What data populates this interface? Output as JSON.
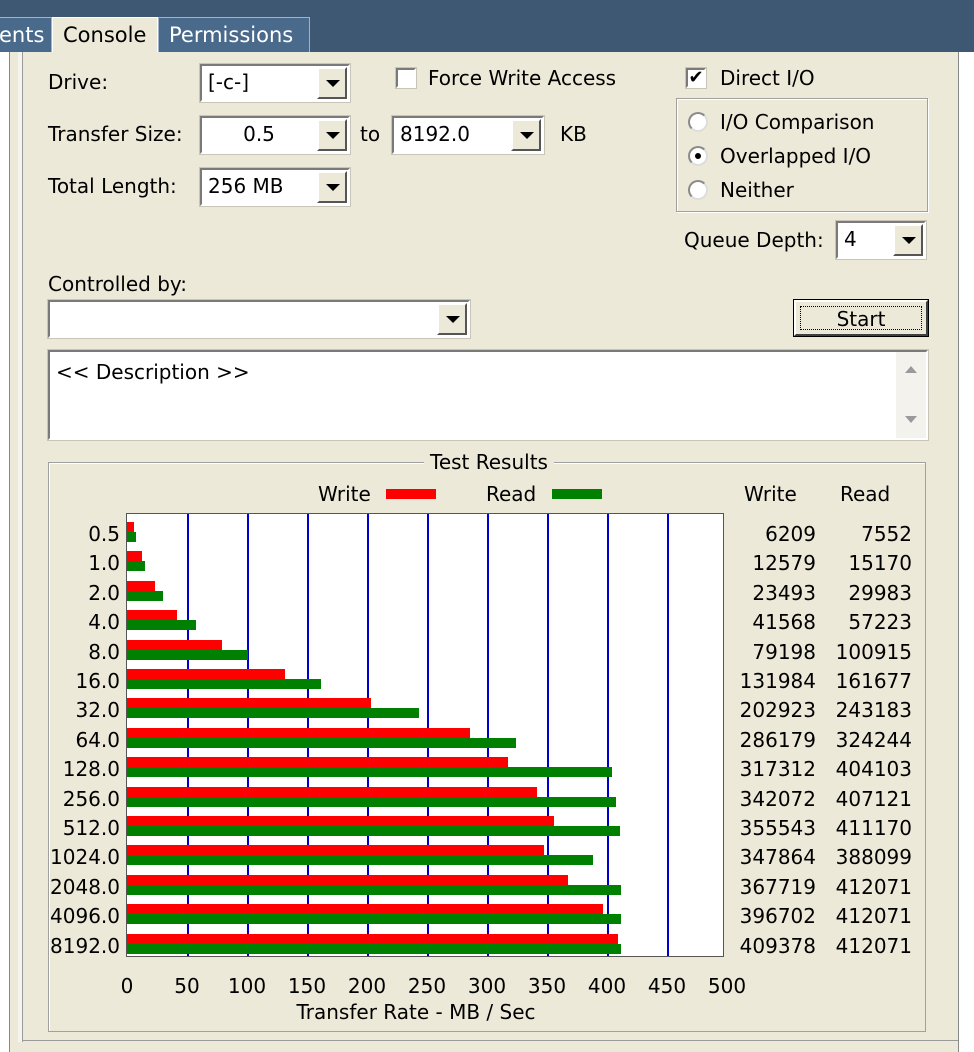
{
  "tabs": [
    {
      "label": "ents",
      "active": false
    },
    {
      "label": "Console",
      "active": true
    },
    {
      "label": "Permissions",
      "active": false
    }
  ],
  "drive": {
    "label": "Drive:",
    "value": "[-c-]"
  },
  "transfer_size": {
    "label": "Transfer Size:",
    "from": "0.5",
    "to_label": "to",
    "to": "8192.0",
    "unit": "KB"
  },
  "total_length": {
    "label": "Total Length:",
    "value": "256 MB"
  },
  "force_write": {
    "label": "Force Write Access",
    "checked": false
  },
  "direct_io": {
    "label": "Direct I/O",
    "checked": true,
    "check_glyph": "✔"
  },
  "io_mode": {
    "options": [
      {
        "label": "I/O Comparison",
        "selected": false
      },
      {
        "label": "Overlapped I/O",
        "selected": true
      },
      {
        "label": "Neither",
        "selected": false
      }
    ]
  },
  "queue_depth": {
    "label": "Queue Depth:",
    "value": "4"
  },
  "controlled_by": {
    "label": "Controlled by:",
    "value": ""
  },
  "start_button": "Start",
  "description": "<< Description >>",
  "results": {
    "title": "Test Results",
    "legend_write": "Write",
    "legend_read": "Read",
    "col_write": "Write",
    "col_read": "Read",
    "write_color": "#ff0000",
    "read_color": "#008000"
  },
  "chart_data": {
    "type": "bar",
    "orientation": "horizontal",
    "xlabel": "Transfer Rate - MB / Sec",
    "xlim": [
      0,
      500
    ],
    "xticks": [
      0,
      50,
      100,
      150,
      200,
      250,
      300,
      350,
      400,
      450,
      500
    ],
    "categories": [
      "0.5",
      "1.0",
      "2.0",
      "4.0",
      "8.0",
      "16.0",
      "32.0",
      "64.0",
      "128.0",
      "256.0",
      "512.0",
      "1024.0",
      "2048.0",
      "4096.0",
      "8192.0"
    ],
    "series": [
      {
        "name": "Write",
        "color": "#ff0000",
        "values": [
          6209,
          12579,
          23493,
          41568,
          79198,
          131984,
          202923,
          286179,
          317312,
          342072,
          355543,
          347864,
          367719,
          396702,
          409378
        ]
      },
      {
        "name": "Read",
        "color": "#008000",
        "values": [
          7552,
          15170,
          29983,
          57223,
          100915,
          161677,
          243183,
          324244,
          404103,
          407121,
          411170,
          388099,
          412071,
          412071,
          412071
        ]
      }
    ],
    "grid": true,
    "legend_placement": "top-center"
  }
}
